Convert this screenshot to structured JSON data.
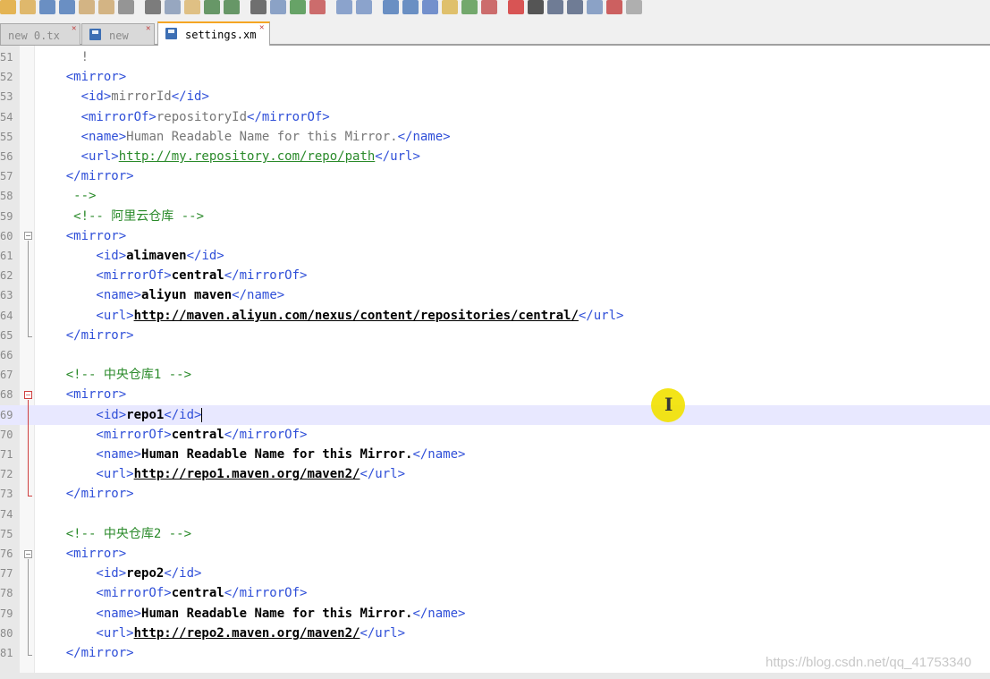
{
  "tabs": [
    {
      "label": "new  0.tx",
      "active": false
    },
    {
      "label": "new",
      "active": false
    },
    {
      "label": "settings.xm",
      "active": true
    }
  ],
  "lines": [
    {
      "num": "51",
      "tokens": [
        {
          "c": "txt",
          "t": "      !"
        }
      ]
    },
    {
      "num": "52",
      "tokens": [
        {
          "c": "tag",
          "t": "    <mirror>"
        }
      ]
    },
    {
      "num": "53",
      "tokens": [
        {
          "c": "tag",
          "t": "      <id>"
        },
        {
          "c": "txt",
          "t": "mirrorId"
        },
        {
          "c": "tag",
          "t": "</id>"
        }
      ]
    },
    {
      "num": "54",
      "tokens": [
        {
          "c": "tag",
          "t": "      <mirrorOf>"
        },
        {
          "c": "txt",
          "t": "repositoryId"
        },
        {
          "c": "tag",
          "t": "</mirrorOf>"
        }
      ]
    },
    {
      "num": "55",
      "tokens": [
        {
          "c": "tag",
          "t": "      <name>"
        },
        {
          "c": "txt",
          "t": "Human Readable Name for this Mirror."
        },
        {
          "c": "tag",
          "t": "</name>"
        }
      ]
    },
    {
      "num": "56",
      "tokens": [
        {
          "c": "tag",
          "t": "      <url>"
        },
        {
          "c": "curl",
          "t": "http://my.repository.com/repo/path"
        },
        {
          "c": "tag",
          "t": "</url>"
        }
      ]
    },
    {
      "num": "57",
      "tokens": [
        {
          "c": "tag",
          "t": "    </mirror>"
        }
      ]
    },
    {
      "num": "58",
      "tokens": [
        {
          "c": "cmt",
          "t": "     -->"
        }
      ]
    },
    {
      "num": "59",
      "tokens": [
        {
          "c": "cmt",
          "t": "     <!-- 阿里云仓库 -->"
        }
      ]
    },
    {
      "num": "60",
      "tokens": [
        {
          "c": "tag",
          "t": "    <mirror>"
        }
      ]
    },
    {
      "num": "61",
      "tokens": [
        {
          "c": "tag",
          "t": "        <id>"
        },
        {
          "c": "val",
          "t": "alimaven"
        },
        {
          "c": "tag",
          "t": "</id>"
        }
      ]
    },
    {
      "num": "62",
      "tokens": [
        {
          "c": "tag",
          "t": "        <mirrorOf>"
        },
        {
          "c": "val",
          "t": "central"
        },
        {
          "c": "tag",
          "t": "</mirrorOf>"
        }
      ]
    },
    {
      "num": "63",
      "tokens": [
        {
          "c": "tag",
          "t": "        <name>"
        },
        {
          "c": "val",
          "t": "aliyun maven"
        },
        {
          "c": "tag",
          "t": "</name>"
        }
      ]
    },
    {
      "num": "64",
      "tokens": [
        {
          "c": "tag",
          "t": "        <url>"
        },
        {
          "c": "uval",
          "t": "http://maven.aliyun.com/nexus/content/repositories/central/"
        },
        {
          "c": "tag",
          "t": "</url>"
        }
      ]
    },
    {
      "num": "65",
      "tokens": [
        {
          "c": "tag",
          "t": "    </mirror>"
        }
      ]
    },
    {
      "num": "66",
      "tokens": []
    },
    {
      "num": "67",
      "tokens": [
        {
          "c": "cmt",
          "t": "    <!-- 中央仓库1 -->"
        }
      ]
    },
    {
      "num": "68",
      "tokens": [
        {
          "c": "tag",
          "t": "    <mirror>"
        }
      ]
    },
    {
      "num": "69",
      "tokens": [
        {
          "c": "tag",
          "t": "        <id>"
        },
        {
          "c": "val",
          "t": "repo1"
        },
        {
          "c": "tag",
          "t": "</id>"
        }
      ],
      "current": true
    },
    {
      "num": "70",
      "tokens": [
        {
          "c": "tag",
          "t": "        <mirrorOf>"
        },
        {
          "c": "val",
          "t": "central"
        },
        {
          "c": "tag",
          "t": "</mirrorOf>"
        }
      ]
    },
    {
      "num": "71",
      "tokens": [
        {
          "c": "tag",
          "t": "        <name>"
        },
        {
          "c": "val",
          "t": "Human Readable Name for this Mirror."
        },
        {
          "c": "tag",
          "t": "</name>"
        }
      ]
    },
    {
      "num": "72",
      "tokens": [
        {
          "c": "tag",
          "t": "        <url>"
        },
        {
          "c": "uval",
          "t": "http://repo1.maven.org/maven2/"
        },
        {
          "c": "tag",
          "t": "</url>"
        }
      ]
    },
    {
      "num": "73",
      "tokens": [
        {
          "c": "tag",
          "t": "    </mirror>"
        }
      ]
    },
    {
      "num": "74",
      "tokens": []
    },
    {
      "num": "75",
      "tokens": [
        {
          "c": "cmt",
          "t": "    <!-- 中央仓库2 -->"
        }
      ]
    },
    {
      "num": "76",
      "tokens": [
        {
          "c": "tag",
          "t": "    <mirror>"
        }
      ]
    },
    {
      "num": "77",
      "tokens": [
        {
          "c": "tag",
          "t": "        <id>"
        },
        {
          "c": "val",
          "t": "repo2"
        },
        {
          "c": "tag",
          "t": "</id>"
        }
      ]
    },
    {
      "num": "78",
      "tokens": [
        {
          "c": "tag",
          "t": "        <mirrorOf>"
        },
        {
          "c": "val",
          "t": "central"
        },
        {
          "c": "tag",
          "t": "</mirrorOf>"
        }
      ]
    },
    {
      "num": "79",
      "tokens": [
        {
          "c": "tag",
          "t": "        <name>"
        },
        {
          "c": "val",
          "t": "Human Readable Name for this Mirror."
        },
        {
          "c": "tag",
          "t": "</name>"
        }
      ]
    },
    {
      "num": "80",
      "tokens": [
        {
          "c": "tag",
          "t": "        <url>"
        },
        {
          "c": "uval",
          "t": "http://repo2.maven.org/maven2/"
        },
        {
          "c": "tag",
          "t": "</url>"
        }
      ]
    },
    {
      "num": "81",
      "tokens": [
        {
          "c": "tag",
          "t": "    </mirror>"
        }
      ]
    }
  ],
  "watermark": "https://blog.csdn.net/qq_41753340",
  "icons": [
    "new-file-icon",
    "open-file-icon",
    "save-icon",
    "save-all-icon",
    "close-icon",
    "close-all-icon",
    "print-icon",
    "cut-icon",
    "copy-icon",
    "paste-icon",
    "undo-icon",
    "redo-icon",
    "find-icon",
    "replace-icon",
    "zoom-in-icon",
    "zoom-out-icon",
    "sync-v-icon",
    "sync-h-icon",
    "word-wrap-icon",
    "show-all-chars-icon",
    "indent-guide-icon",
    "udl-icon",
    "doc-map-icon",
    "function-list-icon",
    "record-macro-icon",
    "stop-macro-icon",
    "play-macro-icon",
    "run-macro-icon",
    "save-macro-icon",
    "encoding-icon",
    "plugin-icon"
  ],
  "colors": {
    "tag": "#2f4fd8",
    "comment": "#2a8a2a",
    "active_tab": "#f5a623",
    "current_line": "#e8e8ff",
    "cursor_highlight": "#f2e200"
  }
}
